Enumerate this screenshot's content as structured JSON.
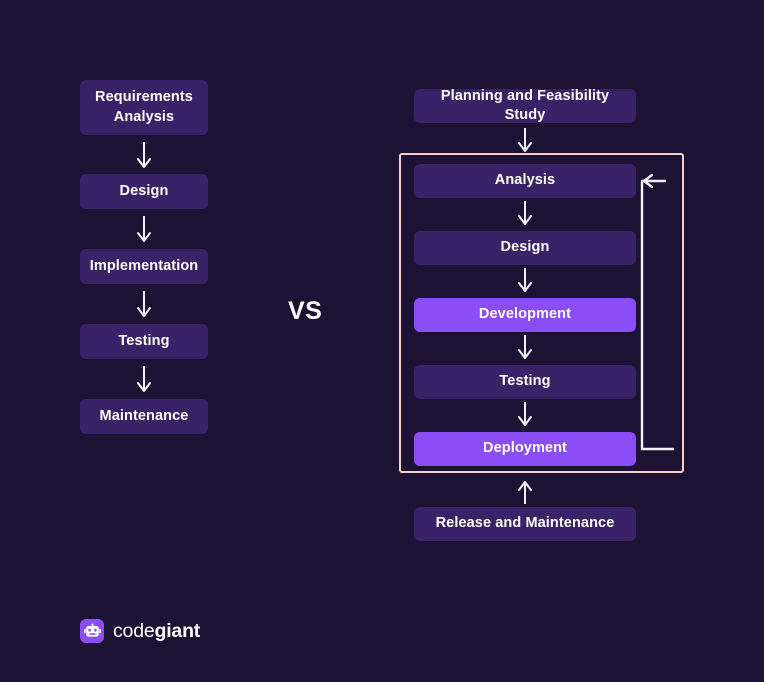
{
  "background_color": "#1c1233",
  "colors": {
    "box_dark": "#392268",
    "box_bright": "#8b4df5",
    "loop_border": "#f7cfc8",
    "connector": "#f2f0f7",
    "text": "#ffffff"
  },
  "comparison": {
    "vs_label": "VS"
  },
  "waterfall": {
    "steps": [
      {
        "label": "Requirements\nAnalysis",
        "highlight": false
      },
      {
        "label": "Design",
        "highlight": false
      },
      {
        "label": "Implementation",
        "highlight": false
      },
      {
        "label": "Testing",
        "highlight": false
      },
      {
        "label": "Maintenance",
        "highlight": false
      }
    ],
    "arrows": [
      "down-arrow",
      "down-arrow",
      "down-arrow",
      "down-arrow"
    ]
  },
  "iterative": {
    "entry": {
      "label": "Planning and Feasibility Study",
      "highlight": false
    },
    "entry_arrow": "down-arrow",
    "loop_steps": [
      {
        "label": "Analysis",
        "highlight": false
      },
      {
        "label": "Design",
        "highlight": false
      },
      {
        "label": "Development",
        "highlight": true
      },
      {
        "label": "Testing",
        "highlight": false
      },
      {
        "label": "Deployment",
        "highlight": true
      }
    ],
    "loop_arrows": [
      "down-arrow",
      "down-arrow",
      "down-arrow",
      "down-arrow"
    ],
    "feedback_connector": "feedback-loop-arrow",
    "exit_arrow": "up-arrow",
    "exit": {
      "label": "Release and Maintenance",
      "highlight": false
    }
  },
  "branding": {
    "logo_mark": "robot-icon",
    "name_part_1": "code",
    "name_part_2": "giant"
  }
}
